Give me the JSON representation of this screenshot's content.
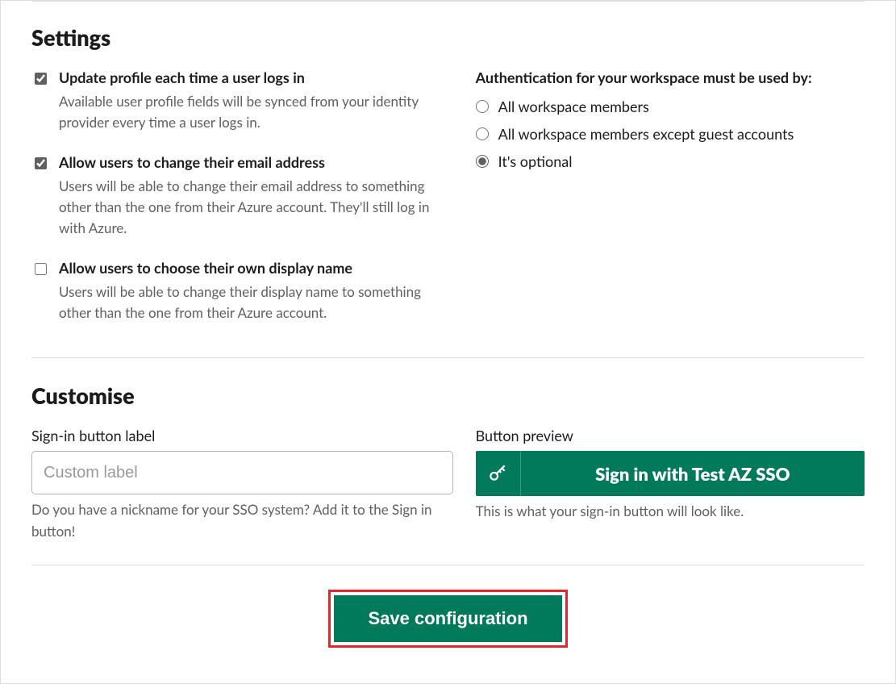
{
  "settings": {
    "heading": "Settings",
    "items": [
      {
        "checked": true,
        "title": "Update profile each time a user logs in",
        "desc": "Available user profile fields will be synced from your identity provider every time a user logs in."
      },
      {
        "checked": true,
        "title": "Allow users to change their email address",
        "desc": "Users will be able to change their email address to something other than the one from their Azure account. They'll still log in with Azure."
      },
      {
        "checked": false,
        "title": "Allow users to choose their own display name",
        "desc": "Users will be able to change their display name to something other than the one from their Azure account."
      }
    ],
    "auth": {
      "heading": "Authentication for your workspace must be used by:",
      "options": [
        {
          "label": "All workspace members",
          "selected": false
        },
        {
          "label": "All workspace members except guest accounts",
          "selected": false
        },
        {
          "label": "It's optional",
          "selected": true
        }
      ]
    }
  },
  "customise": {
    "heading": "Customise",
    "input_label": "Sign-in button label",
    "input_placeholder": "Custom label",
    "input_help": "Do you have a nickname for your SSO system? Add it to the Sign in button!",
    "preview_label": "Button preview",
    "preview_button_text": "Sign in with Test AZ SSO",
    "preview_help": "This is what your sign-in button will look like."
  },
  "actions": {
    "save_label": "Save configuration"
  }
}
